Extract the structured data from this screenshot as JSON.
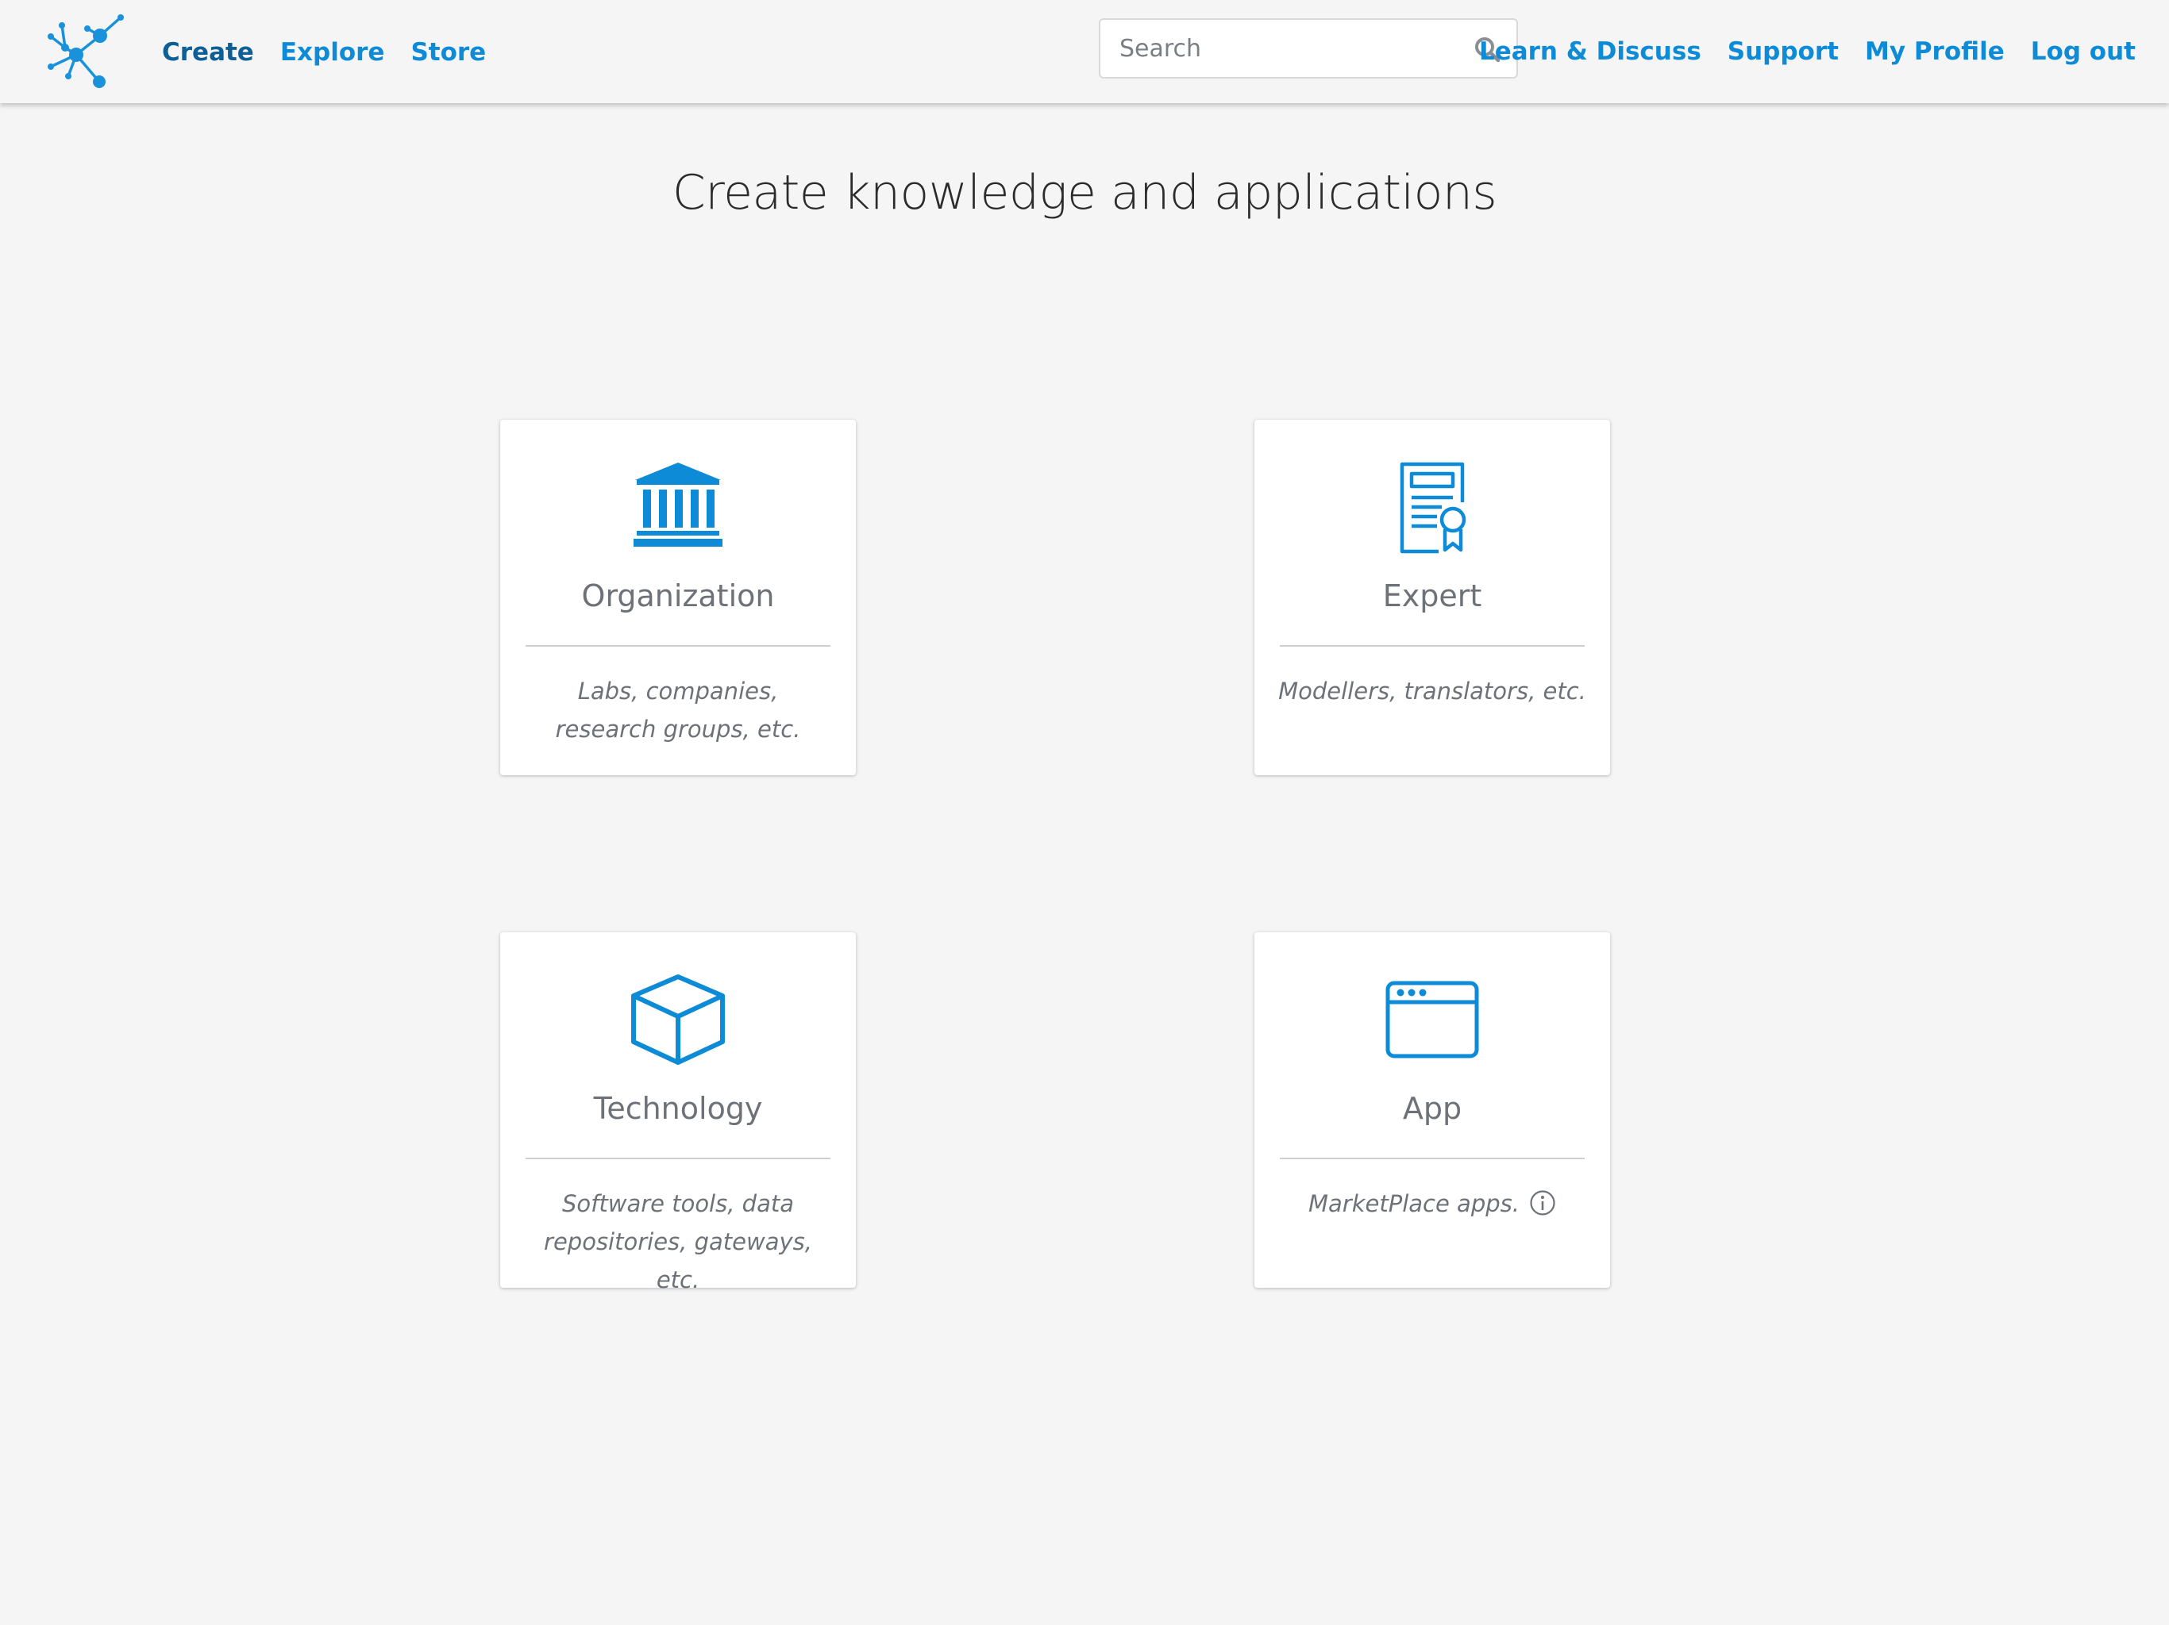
{
  "brand": {
    "logo_icon": "molecule-network-logo-icon",
    "accent_color": "#0d8bd6",
    "active_color": "#0e5f96"
  },
  "nav": {
    "left": [
      {
        "label": "Create",
        "active": true
      },
      {
        "label": "Explore",
        "active": false
      },
      {
        "label": "Store",
        "active": false
      }
    ],
    "search": {
      "placeholder": "Search",
      "value": "",
      "icon": "search-icon"
    },
    "right": [
      {
        "label": "Learn & Discuss"
      },
      {
        "label": "Support"
      },
      {
        "label": "My Profile"
      },
      {
        "label": "Log out"
      }
    ]
  },
  "main": {
    "title": "Create knowledge and applications",
    "cards": [
      {
        "title": "Organization",
        "description": "Labs, companies, research groups, etc.",
        "icon": "institution-building-icon"
      },
      {
        "title": "Expert",
        "description": "Modellers, translators, etc.",
        "icon": "certificate-document-icon"
      },
      {
        "title": "Technology",
        "description": "Software tools, data repositories, gateways, etc.",
        "icon": "cube-icon"
      },
      {
        "title": "App",
        "description": "MarketPlace apps.",
        "icon": "browser-window-icon",
        "info_icon": "info-icon"
      }
    ]
  }
}
